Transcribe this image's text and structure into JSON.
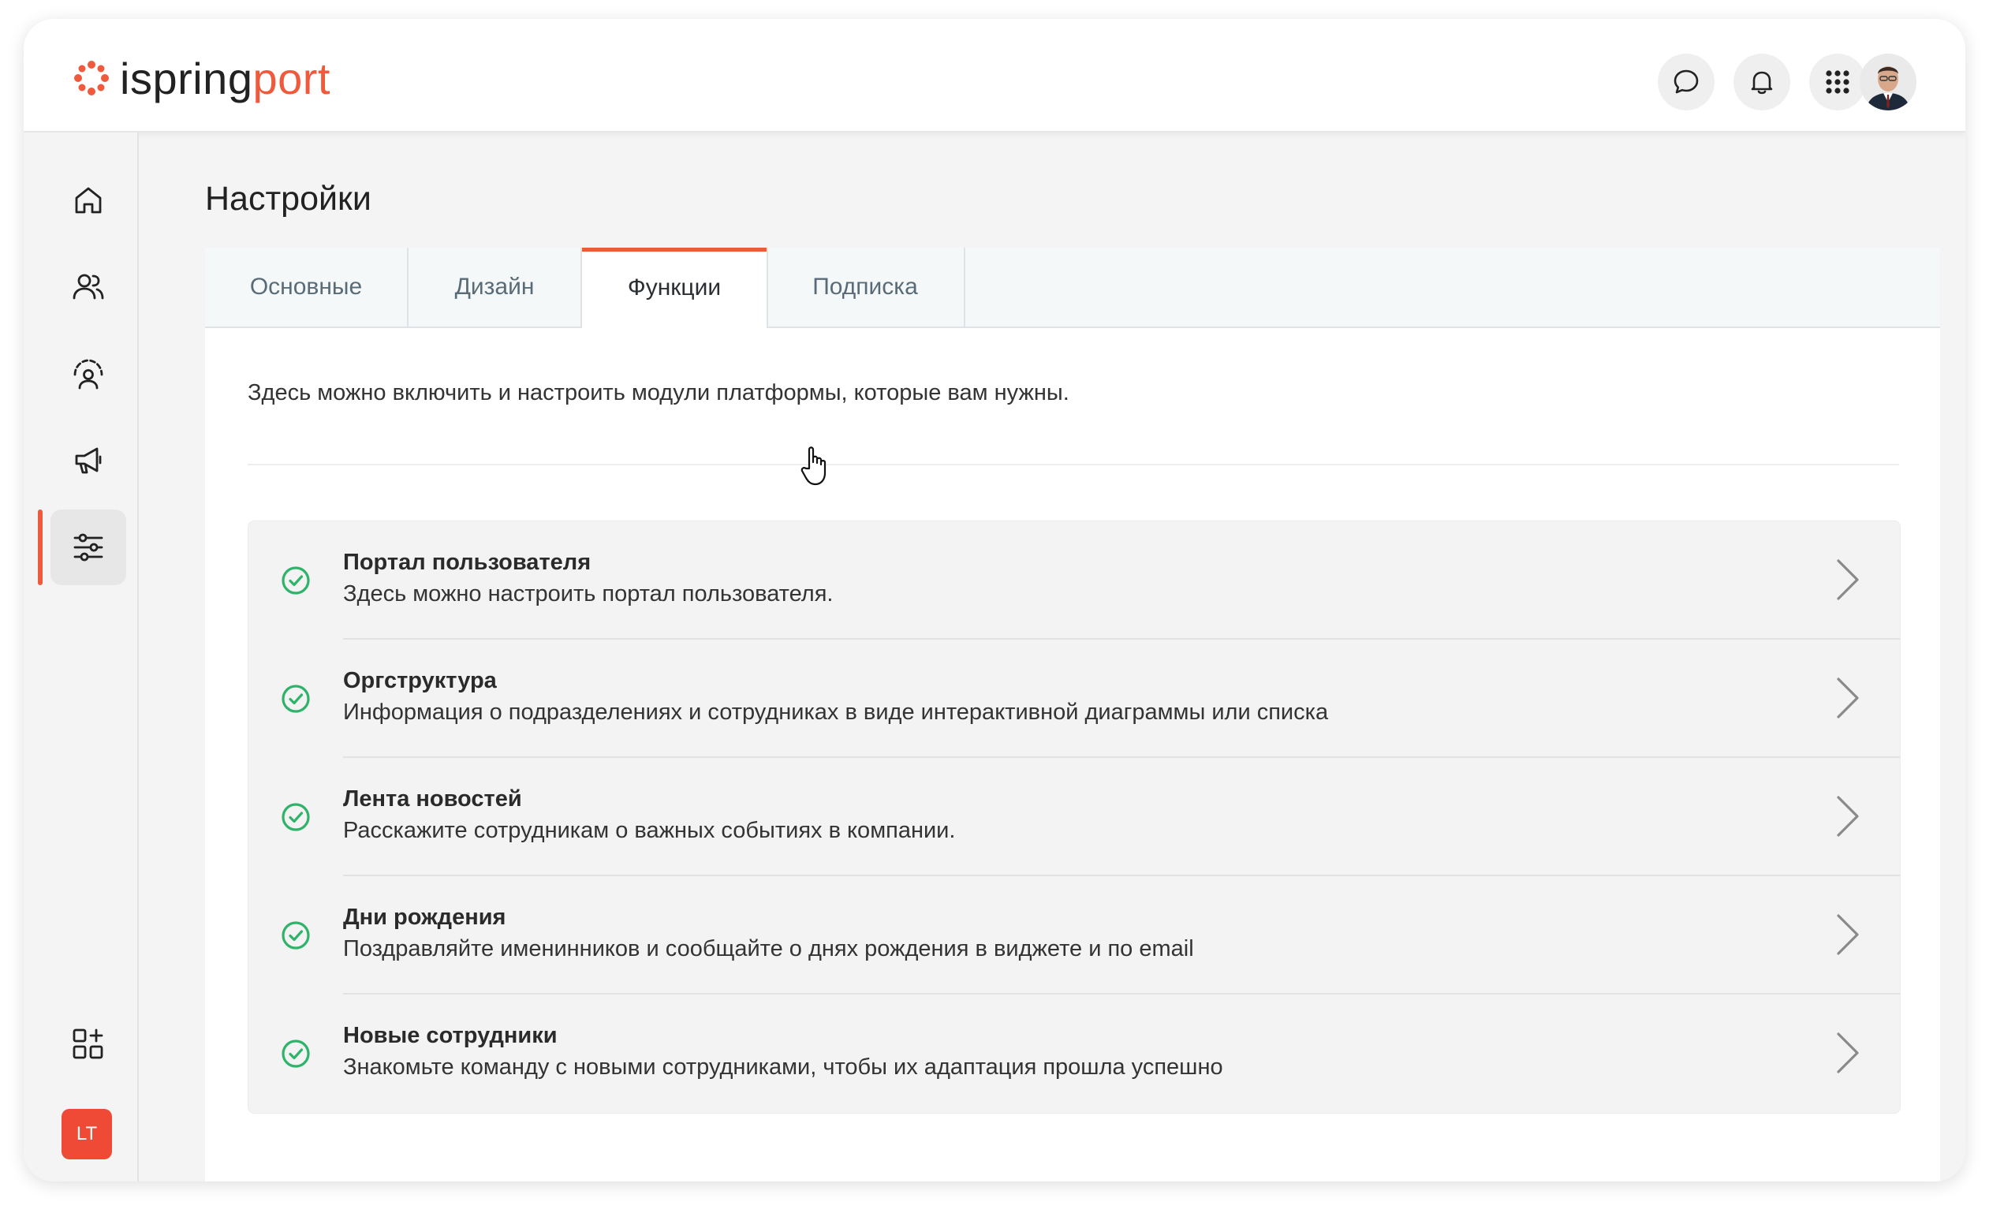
{
  "app": {
    "logo_primary": "ispring",
    "logo_secondary": "port",
    "brand_color": "#ef5a3c",
    "success_color": "#2fb36a"
  },
  "topbar": {
    "icons": [
      "chat-icon",
      "bell-icon",
      "apps-grid-icon",
      "user-avatar"
    ]
  },
  "sidebar": {
    "items": [
      {
        "icon": "home-icon",
        "active": false
      },
      {
        "icon": "users-icon",
        "active": false
      },
      {
        "icon": "user-dashboard-icon",
        "active": false
      },
      {
        "icon": "megaphone-icon",
        "active": false
      },
      {
        "icon": "settings-sliders-icon",
        "active": true
      }
    ],
    "bottom": {
      "add_widget_icon": "add-widget-icon",
      "badge_label": "LT"
    }
  },
  "page": {
    "title": "Настройки",
    "tabs": [
      {
        "label": "Основные",
        "active": false
      },
      {
        "label": "Дизайн",
        "active": false
      },
      {
        "label": "Функции",
        "active": true
      },
      {
        "label": "Подписка",
        "active": false
      }
    ],
    "intro": "Здесь можно включить и настроить модули платформы, которые вам нужны.",
    "modules": [
      {
        "title": "Портал пользователя",
        "description": "Здесь можно настроить портал пользователя.",
        "enabled": true
      },
      {
        "title": "Оргструктура",
        "description": "Информация о подразделениях и сотрудниках в виде интерактивной диаграммы или списка",
        "enabled": true
      },
      {
        "title": "Лента новостей",
        "description": "Расскажите сотрудникам о важных событиях в компании.",
        "enabled": true
      },
      {
        "title": "Дни рождения",
        "description": "Поздравляйте именинников и сообщайте о днях рождения в виджете и по email",
        "enabled": true
      },
      {
        "title": "Новые сотрудники",
        "description": "Знакомьте команду с новыми сотрудниками, чтобы их адаптация прошла успешно",
        "enabled": true
      }
    ]
  }
}
